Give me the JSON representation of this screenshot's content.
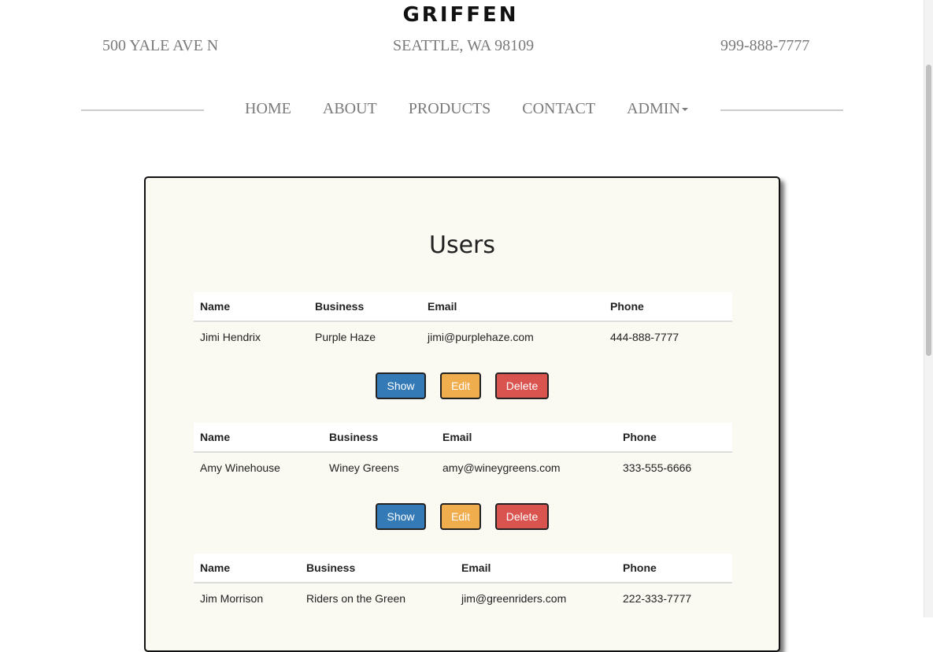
{
  "brand": "GRIFFEN",
  "contact": {
    "address": "500 YALE AVE N",
    "city": "SEATTLE, WA 98109",
    "phone": "999-888-7777"
  },
  "nav": [
    "HOME",
    "ABOUT",
    "PRODUCTS",
    "CONTACT",
    "ADMIN"
  ],
  "page_title": "Users",
  "table_headers": [
    "Name",
    "Business",
    "Email",
    "Phone"
  ],
  "users": [
    {
      "name": "Jimi Hendrix",
      "business": "Purple Haze",
      "email": "jimi@purplehaze.com",
      "phone": "444-888-7777"
    },
    {
      "name": "Amy Winehouse",
      "business": "Winey Greens",
      "email": "amy@wineygreens.com",
      "phone": "333-555-6666"
    },
    {
      "name": "Jim Morrison",
      "business": "Riders on the Green",
      "email": "jim@greenriders.com",
      "phone": "222-333-7777"
    }
  ],
  "actions": {
    "show": "Show",
    "edit": "Edit",
    "delete": "Delete"
  },
  "colors": {
    "show": "#337ab7",
    "edit": "#f0ad4e",
    "delete": "#d9534f",
    "panel": "#faf9f2"
  }
}
